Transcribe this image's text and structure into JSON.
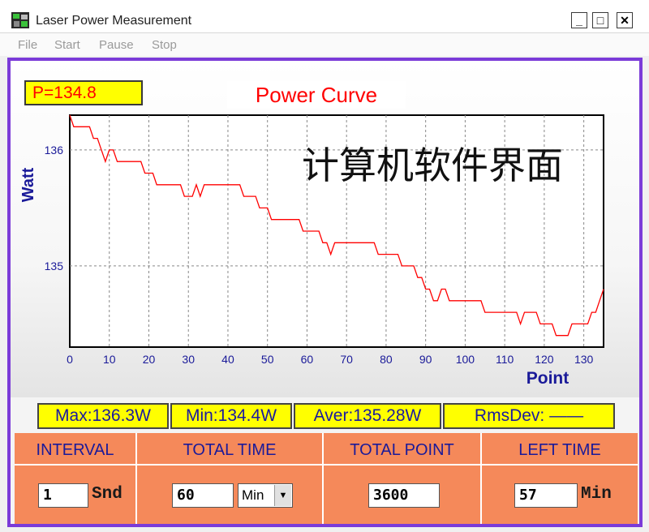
{
  "window": {
    "title": "Laser Power Measurement",
    "minimize": "_",
    "maximize": "□",
    "close": "✕"
  },
  "menu": [
    "File",
    "Start",
    "Pause",
    "Stop"
  ],
  "power_display": "P=134.8",
  "watermark": "计算机软件界面",
  "chart_data": {
    "type": "line",
    "title": "Power Curve",
    "xlabel": "Point",
    "ylabel": "Watt",
    "xlim": [
      0,
      135
    ],
    "ylim": [
      134.3,
      136.3
    ],
    "xticks": [
      0,
      10,
      20,
      30,
      40,
      50,
      60,
      70,
      80,
      90,
      100,
      110,
      120,
      130
    ],
    "yticks": [
      135,
      136
    ],
    "grid": true,
    "line_color": "#ff0000",
    "series": [
      {
        "x": [
          0,
          1,
          2,
          3,
          4,
          5,
          6,
          7,
          8,
          9,
          10,
          11,
          12,
          13,
          14,
          15,
          16,
          17,
          18,
          19,
          20,
          21,
          22,
          23,
          24,
          25,
          26,
          27,
          28,
          29,
          30,
          31,
          32,
          33,
          34,
          35,
          36,
          37,
          38,
          39,
          40,
          41,
          42,
          43,
          44,
          45,
          46,
          47,
          48,
          49,
          50,
          51,
          52,
          53,
          54,
          55,
          56,
          57,
          58,
          59,
          60,
          61,
          62,
          63,
          64,
          65,
          66,
          67,
          68,
          69,
          70,
          71,
          72,
          73,
          74,
          75,
          76,
          77,
          78,
          79,
          80,
          81,
          82,
          83,
          84,
          85,
          86,
          87,
          88,
          89,
          90,
          91,
          92,
          93,
          94,
          95,
          96,
          97,
          98,
          99,
          100,
          101,
          102,
          103,
          104,
          105,
          106,
          107,
          108,
          109,
          110,
          111,
          112,
          113,
          114,
          115,
          116,
          117,
          118,
          119,
          120,
          121,
          122,
          123,
          124,
          125,
          126,
          127,
          128,
          129,
          130,
          131,
          132,
          133,
          134,
          135
        ],
        "values": [
          136.3,
          136.2,
          136.2,
          136.2,
          136.2,
          136.2,
          136.1,
          136.1,
          136.0,
          135.9,
          136.0,
          136.0,
          135.9,
          135.9,
          135.9,
          135.9,
          135.9,
          135.9,
          135.9,
          135.8,
          135.8,
          135.8,
          135.7,
          135.7,
          135.7,
          135.7,
          135.7,
          135.7,
          135.7,
          135.6,
          135.6,
          135.6,
          135.7,
          135.6,
          135.7,
          135.7,
          135.7,
          135.7,
          135.7,
          135.7,
          135.7,
          135.7,
          135.7,
          135.7,
          135.6,
          135.6,
          135.6,
          135.6,
          135.5,
          135.5,
          135.5,
          135.4,
          135.4,
          135.4,
          135.4,
          135.4,
          135.4,
          135.4,
          135.4,
          135.3,
          135.3,
          135.3,
          135.3,
          135.3,
          135.2,
          135.2,
          135.1,
          135.2,
          135.2,
          135.2,
          135.2,
          135.2,
          135.2,
          135.2,
          135.2,
          135.2,
          135.2,
          135.2,
          135.1,
          135.1,
          135.1,
          135.1,
          135.1,
          135.1,
          135.0,
          135.0,
          135.0,
          135.0,
          134.9,
          134.9,
          134.8,
          134.8,
          134.7,
          134.7,
          134.8,
          134.8,
          134.7,
          134.7,
          134.7,
          134.7,
          134.7,
          134.7,
          134.7,
          134.7,
          134.7,
          134.6,
          134.6,
          134.6,
          134.6,
          134.6,
          134.6,
          134.6,
          134.6,
          134.6,
          134.5,
          134.6,
          134.6,
          134.6,
          134.6,
          134.5,
          134.5,
          134.5,
          134.5,
          134.4,
          134.4,
          134.4,
          134.4,
          134.5,
          134.5,
          134.5,
          134.5,
          134.5,
          134.6,
          134.6,
          134.7,
          134.8
        ]
      }
    ]
  },
  "stats": {
    "max": "Max:136.3W",
    "min": "Min:134.4W",
    "aver": "Aver:135.28W",
    "rmsdev": "RmsDev: ——"
  },
  "controls": {
    "interval": {
      "label": "INTERVAL",
      "value": "1",
      "unit": "Snd"
    },
    "total_time": {
      "label": "TOTAL TIME",
      "value": "60",
      "unit": "Min"
    },
    "total_point": {
      "label": "TOTAL POINT",
      "value": "3600"
    },
    "left_time": {
      "label": "LEFT TIME",
      "value": "57",
      "unit": "Min"
    }
  },
  "colors": {
    "frame_border": "#7b3bd8",
    "control_panel": "#f5895a",
    "highlight": "#ffff00",
    "series_line": "#ff0000",
    "label_blue": "#1a1a99"
  }
}
